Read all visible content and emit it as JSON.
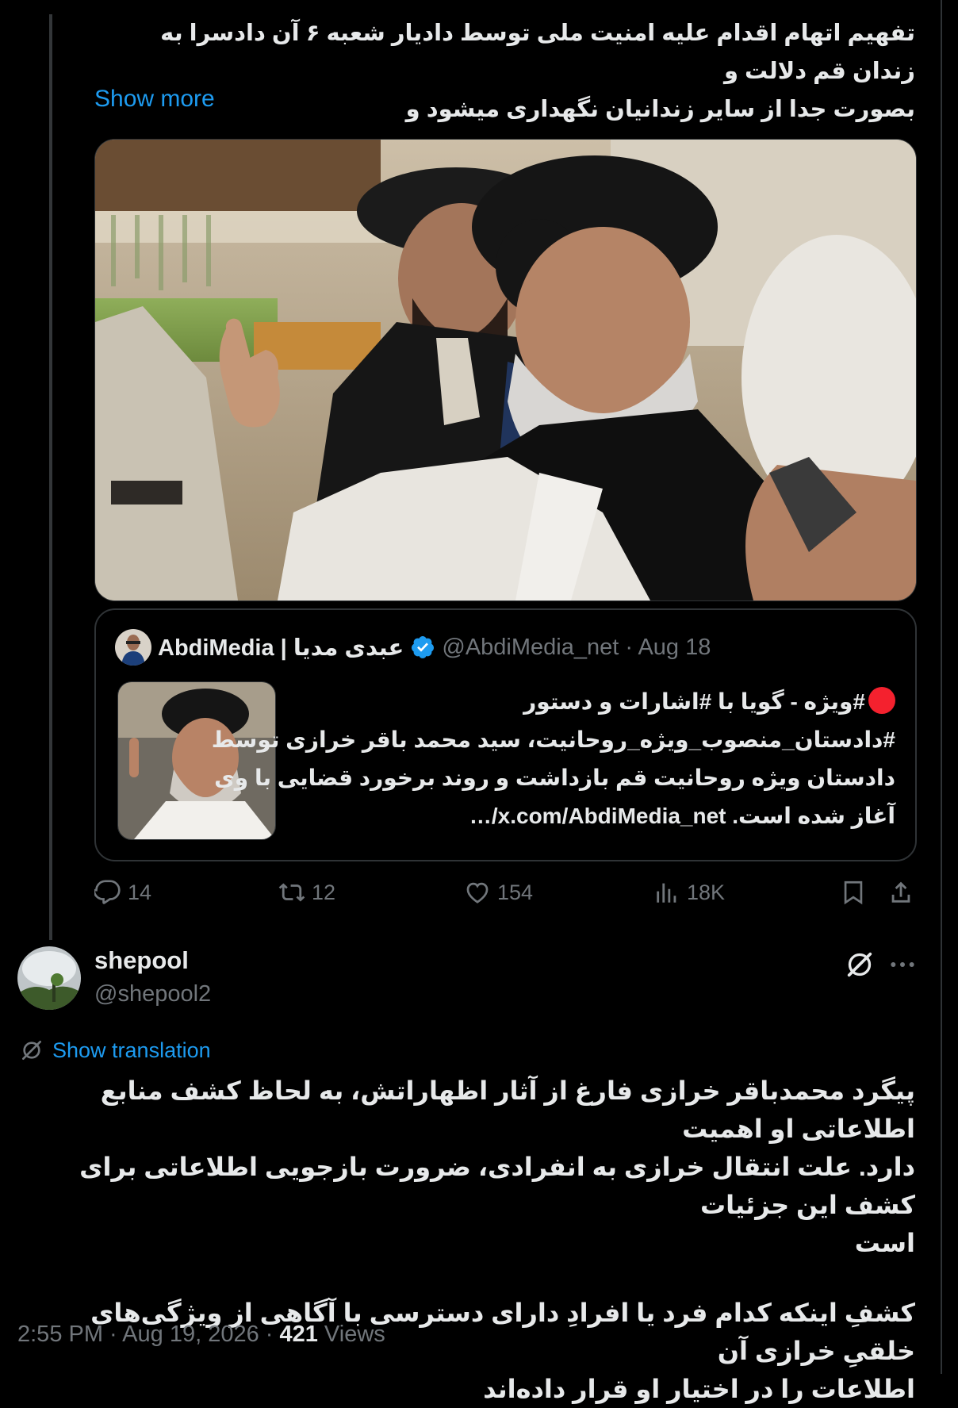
{
  "parent_post": {
    "text_lines": [
      "تفهیم اتهام اقدام علیه امنیت ملی توسط دادیار شعبه ۶ آن دادسرا به زندان قم دلالت و",
      "بصورت جدا از سایر زندانیان نگهداری میشود و"
    ],
    "show_more": "Show more",
    "media_icon": "photo-three-clerics",
    "quote": {
      "name": "AbdiMedia | عبدی مدیا",
      "handle_date": "@AbdiMedia_net · Aug 18",
      "verified_icon": "verified-badge-icon",
      "text_lines": [
        "#ویژه - گویا با #اشارات و دستور",
        "#دادستان_منصوب_ویژه_روحانیت، سید محمد باقر خرازی توسط",
        "دادستان ویژه روحانیت قم بازداشت و روند برخورد قضایی با وی",
        "آغاز شده است.  x.com/AbdiMedia_net/…"
      ]
    },
    "actions": {
      "replies": "14",
      "reposts": "12",
      "likes": "154",
      "views": "18K"
    }
  },
  "reply_post": {
    "display_name": "shepool",
    "handle": "@shepool2",
    "show_translation": "Show translation",
    "paragraph_1": [
      "پیگرد محمدباقر خرازی فارغ از آثار اظهاراتش، به لحاظ کشف منابع اطلاعاتی او اهمیت",
      "دارد. علت انتقال خرازی به انفرادی، ضرورت بازجویی اطلاعاتی برای کشف این جزئیات",
      "است"
    ],
    "paragraph_2": [
      "کشفِ اینکه کدام فرد یا افرادِ دارای دسترسی با آگاهی از ویژگی‌های خلقیِ خرازی آن",
      "اطلاعات را در اختیار او قرار داده‌اند"
    ],
    "time_date": "2:55 PM · Aug 19, 2026 · ",
    "views_count": "421",
    "views_label": " Views"
  },
  "colors": {
    "accent": "#1d9bf0",
    "muted": "#71767b",
    "text": "#e7e9ea",
    "background": "#000000",
    "red_dot": "#f4212e"
  }
}
